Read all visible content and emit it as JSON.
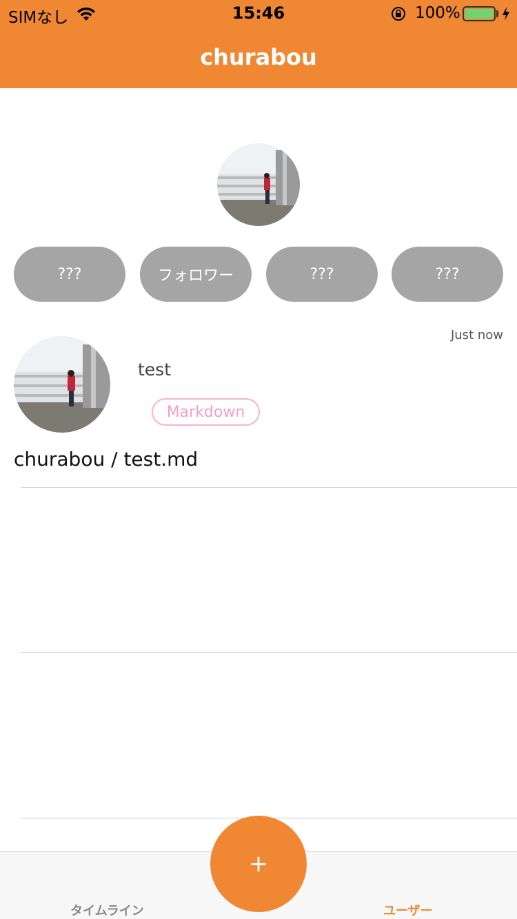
{
  "status_bar": {
    "carrier": "SIMなし",
    "time": "15:46",
    "battery_percent": "100%",
    "battery_level": 1.0,
    "icons": [
      "wifi-icon",
      "orientation-lock-icon",
      "battery-icon",
      "charging-bolt-icon"
    ]
  },
  "nav": {
    "title": "churabou"
  },
  "profile": {
    "stats_buttons": [
      {
        "label": "???"
      },
      {
        "label": "フォロワー"
      },
      {
        "label": "???"
      },
      {
        "label": "???"
      }
    ]
  },
  "post": {
    "time": "Just now",
    "title": "test",
    "tag": "Markdown",
    "path": "churabou / test.md"
  },
  "fab": {
    "label": "+"
  },
  "tabbar": {
    "timeline_label": "タイムライン",
    "user_label": "ユーザー"
  },
  "colors": {
    "accent": "#ef8733",
    "pill_gray": "#a5a5a5",
    "tag_pink": "#f2a0c4",
    "tab_inactive": "#8a8a8a"
  }
}
